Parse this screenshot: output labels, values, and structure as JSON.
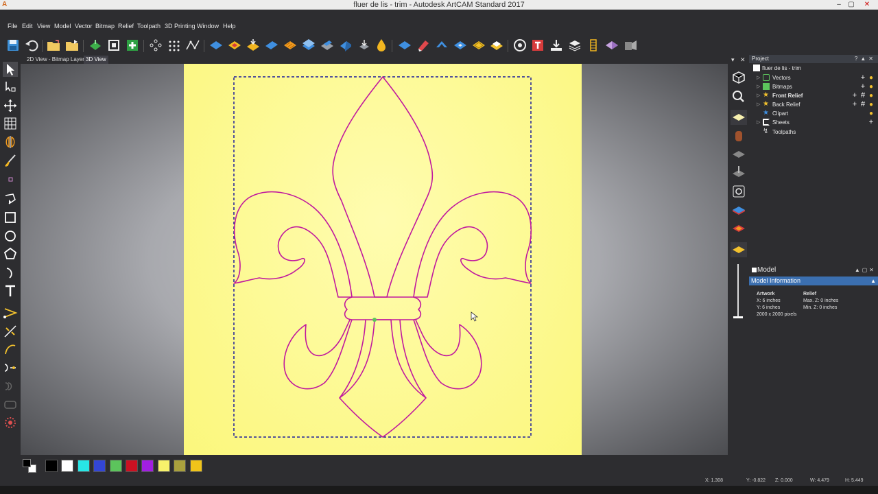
{
  "window": {
    "title": "fluer de lis - trim - Autodesk ArtCAM Standard 2017",
    "app_icon": "artcam-logo-icon",
    "buttons": [
      "minimize",
      "maximize",
      "close"
    ]
  },
  "menu": [
    "File",
    "Edit",
    "View",
    "Model",
    "Vector",
    "Bitmap",
    "Relief",
    "Toolpath",
    "3D Printing",
    "Window",
    "Help"
  ],
  "tabs": [
    {
      "label": "2D View - Bitmap Layer",
      "active": false
    },
    {
      "label": "3D View",
      "active": true
    }
  ],
  "toolbar_icons": [
    "save-icon",
    "undo-icon",
    "open-folder-icon",
    "open-model-icon",
    "view-relief-icon",
    "model-size-icon",
    "add-icon",
    "nodes-icon",
    "grid-points-icon",
    "vector-path-icon",
    "relief-flat-icon",
    "relief-dome-icon",
    "relief-add-icon",
    "relief-angle-icon",
    "relief-layer-icon",
    "relief-stack-icon",
    "relief-wrap-icon",
    "relief-smooth-icon",
    "relief-drop-icon",
    "sculpt-icon",
    "eraser-icon",
    "shape-editor-icon",
    "extrude-icon",
    "texture-icon",
    "relief-fill-icon",
    "sphere-icon",
    "text-tool-icon",
    "export-icon",
    "layers-icon",
    "fade-icon",
    "tilt-icon",
    "toolpath-icon"
  ],
  "left_tools": [
    "select-pointer-icon",
    "node-edit-icon",
    "transform-icon",
    "grid-icon",
    "mirror-icon",
    "brush-icon",
    "rectangle-small-icon",
    "polyline-icon",
    "rectangle-icon",
    "circle-icon",
    "polygon-icon",
    "arc-icon",
    "text-icon",
    "vector-node-icon",
    "snap-icon",
    "curve-icon",
    "join-icon",
    "offset-icon",
    "tab-icon",
    "cut-tool-icon"
  ],
  "project": {
    "header": "Project",
    "controls": [
      "?",
      "pin",
      "close"
    ],
    "items": [
      {
        "label": "fluer de lis - trim",
        "level": 0,
        "icon": "document-icon",
        "bold": false
      },
      {
        "label": "Vectors",
        "level": 1,
        "icon": "vector-layer-icon",
        "bold": false,
        "actions": [
          "add",
          "bulb"
        ]
      },
      {
        "label": "Bitmaps",
        "level": 1,
        "icon": "bitmap-layer-icon",
        "bold": false,
        "actions": [
          "add",
          "bulb"
        ]
      },
      {
        "label": "Front Relief",
        "level": 1,
        "icon": "star-icon",
        "bold": true,
        "actions": [
          "add",
          "grid",
          "bulb"
        ]
      },
      {
        "label": "Back Relief",
        "level": 1,
        "icon": "star-icon",
        "bold": false,
        "actions": [
          "add",
          "grid",
          "bulb"
        ]
      },
      {
        "label": "Clipart",
        "level": 1,
        "icon": "clipart-icon",
        "bold": false,
        "actions": [
          "bulb"
        ]
      },
      {
        "label": "Sheets",
        "level": 1,
        "icon": "sheets-icon",
        "bold": false,
        "actions": [
          "add"
        ]
      },
      {
        "label": "Toolpaths",
        "level": 1,
        "icon": "toolpaths-icon",
        "bold": false
      }
    ]
  },
  "model_panel": {
    "header": "Model",
    "subheader": "Model Information",
    "artwork_title": "Artwork",
    "artwork_x": "X: 6 inches",
    "artwork_y": "Y: 6 inches",
    "artwork_pixels": "2000 x 2000 pixels",
    "relief_title": "Relief",
    "relief_max": "Max. Z: 0 inches",
    "relief_min": "Min. Z: 0 inches"
  },
  "palette": [
    "#000000",
    "#ffffff",
    "#28e6e6",
    "#3346d6",
    "#5cc45c",
    "#cc1122",
    "#a11fe0",
    "#f7f26b",
    "#a9a03d",
    "#f0c41a"
  ],
  "status": {
    "x": "X: 1.308",
    "y": "Y: -0.822",
    "z": "Z: 0.000",
    "w": "W: 4.479",
    "h": "H: 5.449"
  },
  "colors": {
    "sheet": "#fdfa8f",
    "vector": "#c0189e",
    "selection": "#1a1a9c",
    "accent": "#3b6fb0"
  }
}
